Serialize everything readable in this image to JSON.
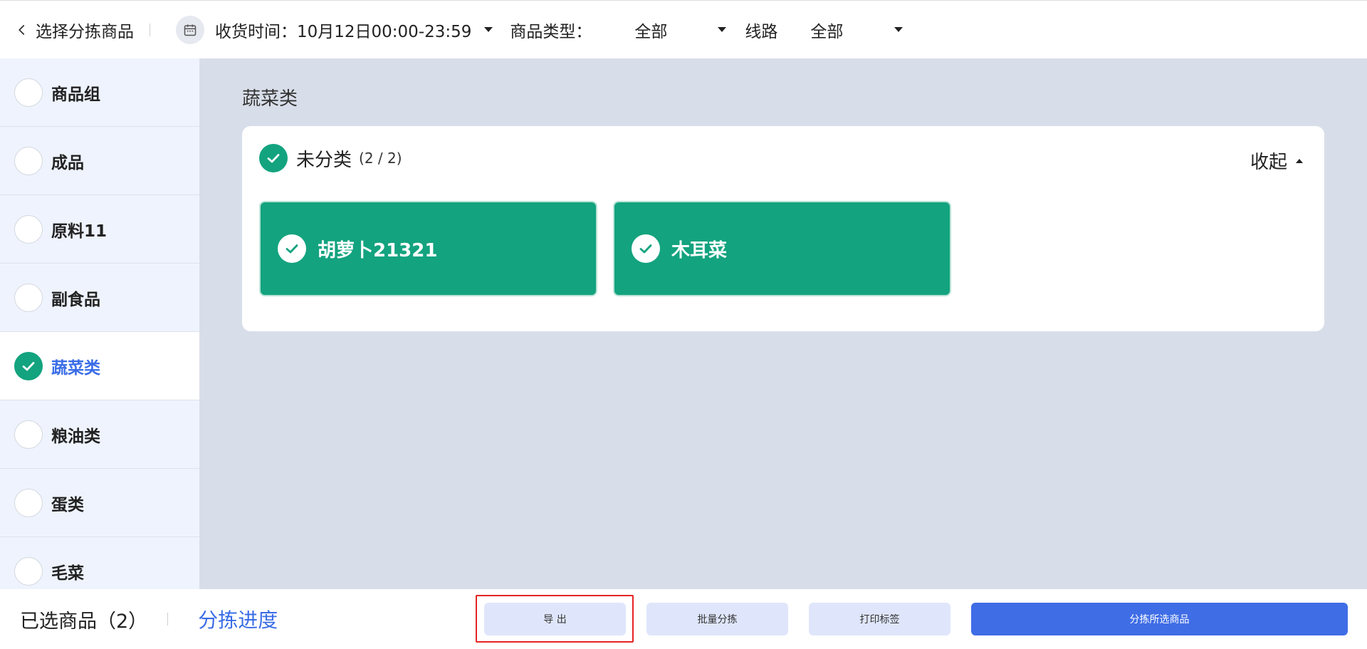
{
  "header": {
    "back_title": "选择分拣商品",
    "time_label": "收货时间：",
    "time_value": "10月12日00:00-23:59",
    "type_label": "商品类型：",
    "type_value": "全部",
    "route_label": "线路",
    "route_value": "全部"
  },
  "sidebar": {
    "items": [
      {
        "label": "商品组",
        "checked": false
      },
      {
        "label": "成品",
        "checked": false
      },
      {
        "label": "原料11",
        "checked": false
      },
      {
        "label": "副食品",
        "checked": false
      },
      {
        "label": "蔬菜类",
        "checked": true
      },
      {
        "label": "粮油类",
        "checked": false
      },
      {
        "label": "蛋类",
        "checked": false
      },
      {
        "label": "毛菜",
        "checked": false
      }
    ]
  },
  "main": {
    "section_title": "蔬菜类",
    "group": {
      "name": "未分类",
      "count": "(2 / 2)",
      "collapse_label": "收起",
      "items": [
        {
          "label": "胡萝卜21321"
        },
        {
          "label": "木耳菜"
        }
      ]
    }
  },
  "footer": {
    "selected_label": "已选商品（2）",
    "progress_label": "分拣进度",
    "export_label": "导 出",
    "batch_label": "批量分拣",
    "print_label": "打印标签",
    "sort_selected_label": "分拣所选商品"
  },
  "colors": {
    "accent_green": "#13a37f",
    "primary_blue": "#3f6de6",
    "highlight_red": "#e62424"
  }
}
